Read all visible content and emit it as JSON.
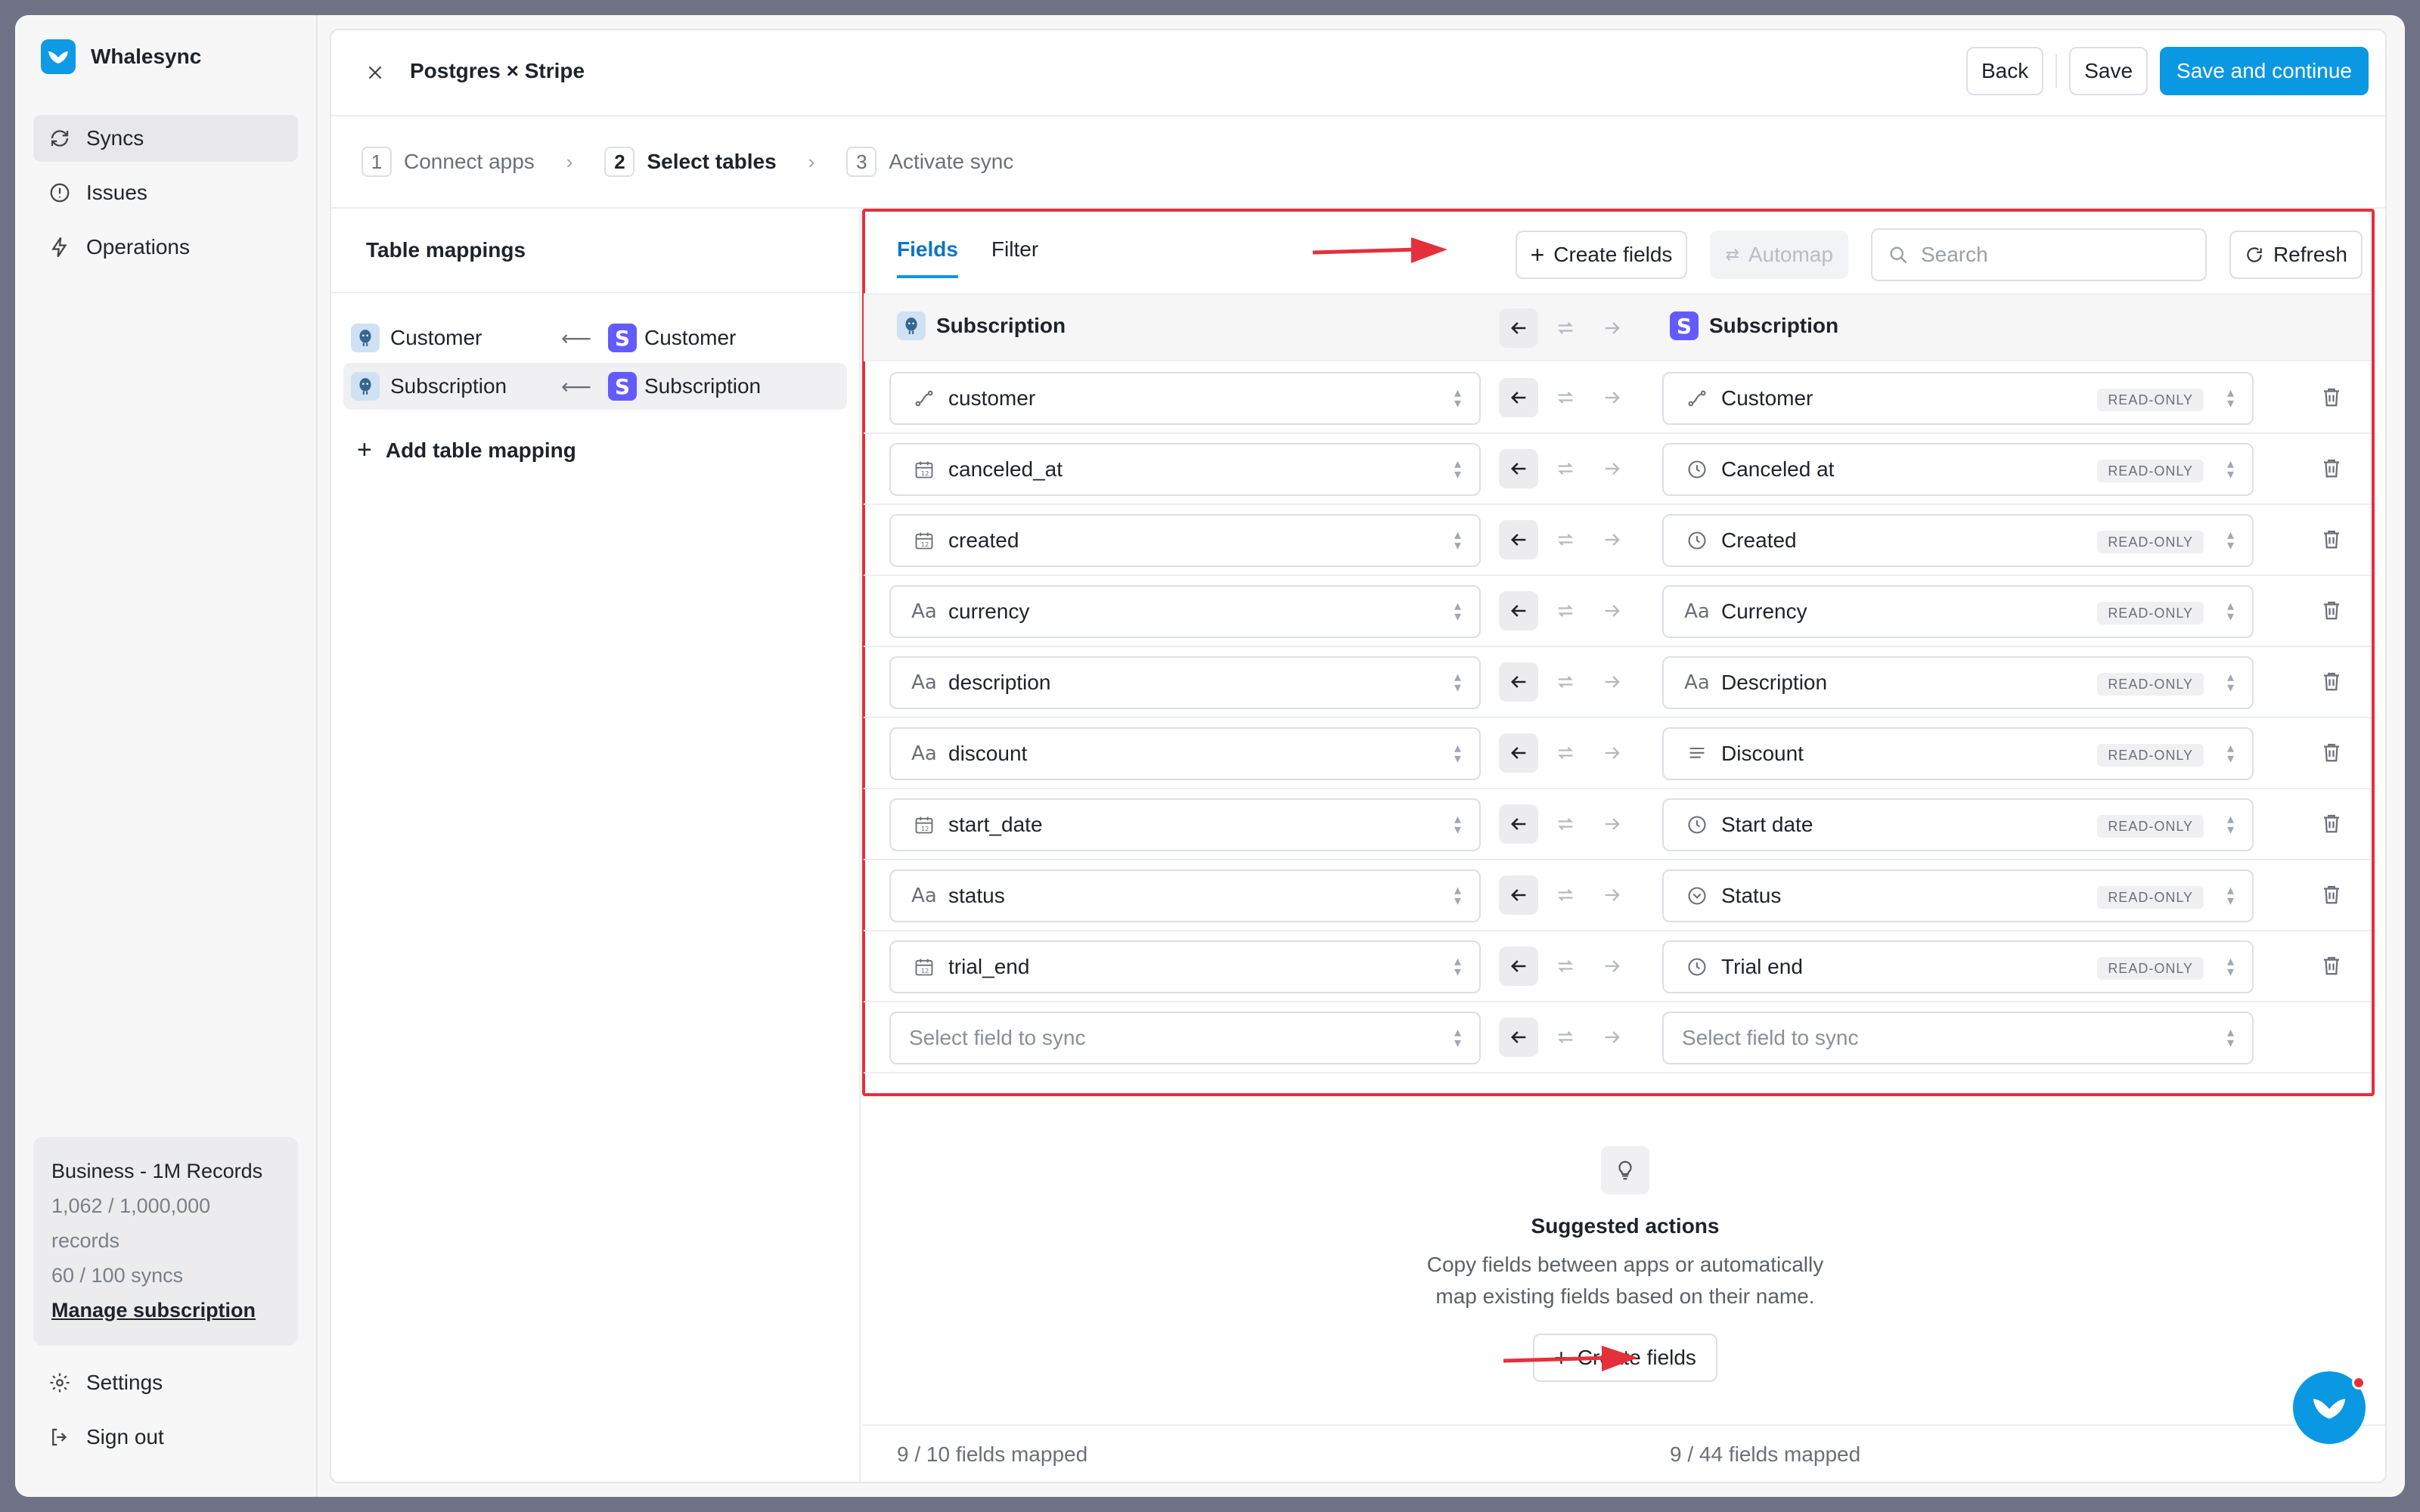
{
  "app": {
    "name": "Whalesync"
  },
  "nav": {
    "items": [
      {
        "label": "Syncs",
        "icon": "sync-icon",
        "active": true
      },
      {
        "label": "Issues",
        "icon": "alert-circle-icon",
        "active": false
      },
      {
        "label": "Operations",
        "icon": "bolt-icon",
        "active": false
      }
    ],
    "bottom": [
      {
        "label": "Settings",
        "icon": "gear-icon"
      },
      {
        "label": "Sign out",
        "icon": "sign-out-icon"
      }
    ]
  },
  "plan": {
    "title": "Business - 1M Records",
    "records_line1": "1,062 / 1,000,000",
    "records_line2": "records",
    "syncs": "60 / 100 syncs",
    "manage": "Manage subscription"
  },
  "header": {
    "title": "Postgres × Stripe",
    "back": "Back",
    "save": "Save",
    "save_continue": "Save and continue"
  },
  "steps": [
    {
      "num": "1",
      "label": "Connect apps"
    },
    {
      "num": "2",
      "label": "Select tables"
    },
    {
      "num": "3",
      "label": "Activate sync"
    }
  ],
  "left_panel": {
    "title": "Table mappings",
    "mappings": [
      {
        "source": "Customer",
        "dest": "Customer",
        "selected": false
      },
      {
        "source": "Subscription",
        "dest": "Subscription",
        "selected": true
      }
    ],
    "add": "Add table mapping"
  },
  "fields_panel": {
    "tabs": [
      "Fields",
      "Filter"
    ],
    "create_fields": "Create fields",
    "automap": "Automap",
    "search_placeholder": "Search",
    "refresh": "Refresh",
    "source_table": "Subscription",
    "dest_table": "Subscription",
    "read_only": "READ-ONLY",
    "select_placeholder": "Select field to sync",
    "rows": [
      {
        "left": "customer",
        "left_icon": "link-icon",
        "right": "Customer",
        "right_icon": "link-icon"
      },
      {
        "left": "canceled_at",
        "left_icon": "calendar-icon",
        "right": "Canceled at",
        "right_icon": "clock-icon"
      },
      {
        "left": "created",
        "left_icon": "calendar-icon",
        "right": "Created",
        "right_icon": "clock-icon"
      },
      {
        "left": "currency",
        "left_icon": "text-icon",
        "right": "Currency",
        "right_icon": "text-icon"
      },
      {
        "left": "description",
        "left_icon": "text-icon",
        "right": "Description",
        "right_icon": "text-icon"
      },
      {
        "left": "discount",
        "left_icon": "text-icon",
        "right": "Discount",
        "right_icon": "lines-icon"
      },
      {
        "left": "start_date",
        "left_icon": "calendar-icon",
        "right": "Start date",
        "right_icon": "clock-icon"
      },
      {
        "left": "status",
        "left_icon": "text-icon",
        "right": "Status",
        "right_icon": "chevron-circle-icon"
      },
      {
        "left": "trial_end",
        "left_icon": "calendar-icon",
        "right": "Trial end",
        "right_icon": "clock-icon"
      }
    ]
  },
  "suggested": {
    "title": "Suggested actions",
    "line1": "Copy fields between apps or automatically",
    "line2": "map existing fields based on their name.",
    "button": "Create fields"
  },
  "footer": {
    "left": "9 / 10 fields mapped",
    "right": "9 / 44 fields mapped"
  },
  "colors": {
    "accent": "#0b98e2",
    "highlight": "#e5303c",
    "stripe": "#635bff"
  }
}
